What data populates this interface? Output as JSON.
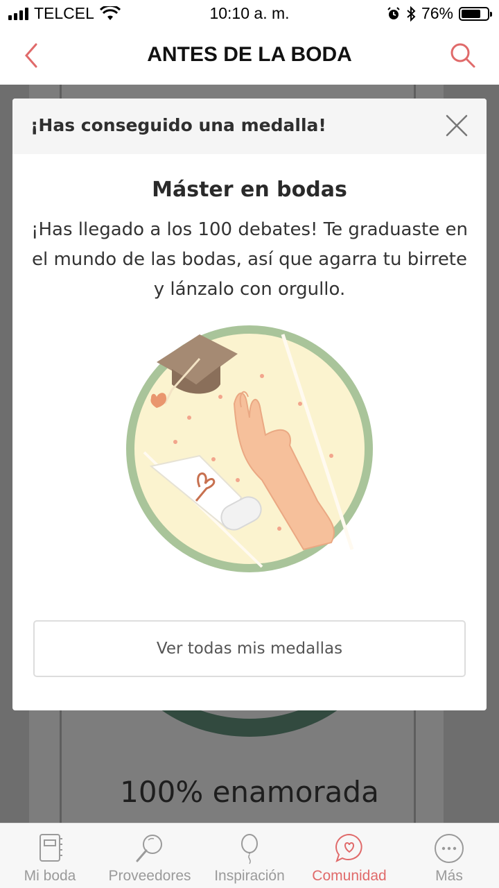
{
  "status_bar": {
    "carrier": "TELCEL",
    "time": "10:10 a. m.",
    "battery": "76%",
    "battery_level": 0.76
  },
  "header": {
    "title": "ANTES DE LA BODA",
    "back_icon": "chevron-left-icon",
    "search_icon": "search-icon"
  },
  "background": {
    "progress_text": "100% enamorada"
  },
  "modal": {
    "header_title": "¡Has conseguido una medalla!",
    "medal_title": "Máster en bodas",
    "medal_description": "¡Has llegado a los 100 debates! Te graduaste en el mundo de las bodas, así que agarra tu birrete y lánzalo con orgullo.",
    "button_label": "Ver todas mis medallas",
    "close_icon": "close-icon"
  },
  "tabbar": {
    "items": [
      {
        "label": "Mi boda",
        "icon": "notebook-icon",
        "active": false
      },
      {
        "label": "Proveedores",
        "icon": "magnifier-icon",
        "active": false
      },
      {
        "label": "Inspiración",
        "icon": "balloon-icon",
        "active": false
      },
      {
        "label": "Comunidad",
        "icon": "chat-heart-icon",
        "active": true
      },
      {
        "label": "Más",
        "icon": "more-icon",
        "active": false
      }
    ]
  },
  "colors": {
    "accent": "#e06a6a",
    "tab_inactive": "#9a9a9a",
    "medal_ring": "#a9c49a",
    "medal_fill": "#fbf3cf"
  }
}
